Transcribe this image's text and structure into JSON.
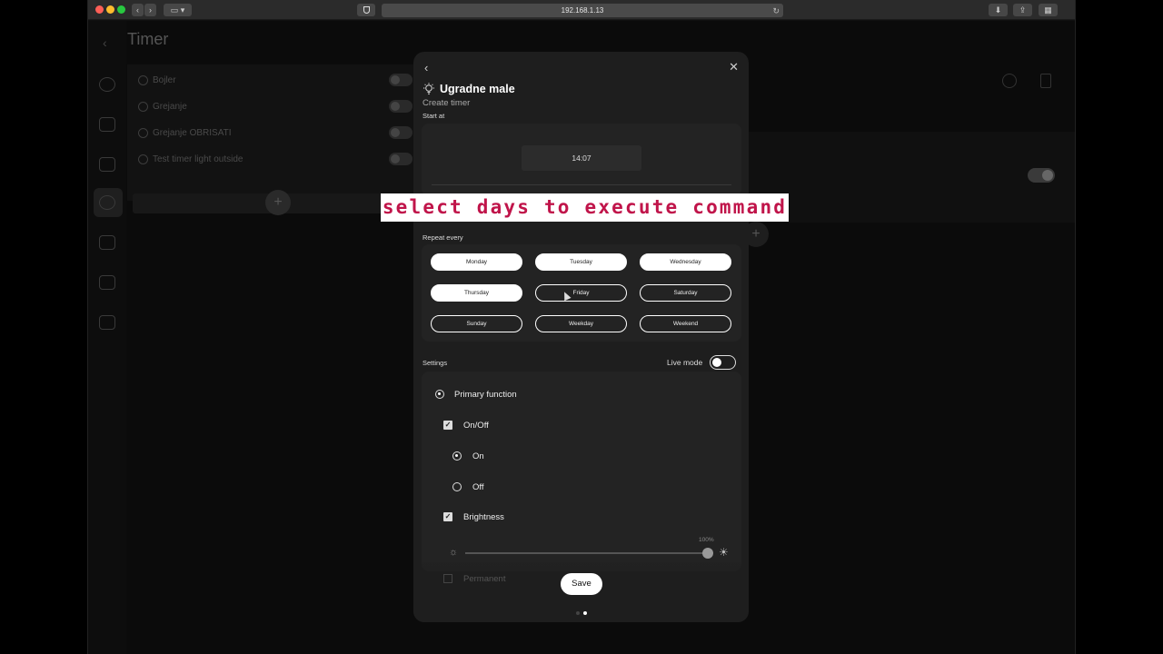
{
  "browser": {
    "url": "192.168.1.13"
  },
  "background": {
    "title": "Timer",
    "timers": [
      {
        "name": "Bojler"
      },
      {
        "name": "Grejanje"
      },
      {
        "name": "Grejanje OBRISATI"
      },
      {
        "name": "Test timer light outside"
      }
    ]
  },
  "modal": {
    "title": "Ugradne male",
    "subtitle": "Create timer",
    "start_label": "Start at",
    "start_time": "14:07",
    "repeat_label": "Repeat every",
    "days": [
      {
        "label": "Monday",
        "selected": true
      },
      {
        "label": "Tuesday",
        "selected": true
      },
      {
        "label": "Wednesday",
        "selected": true
      },
      {
        "label": "Thursday",
        "selected": true
      },
      {
        "label": "Friday",
        "selected": false
      },
      {
        "label": "Saturday",
        "selected": false
      },
      {
        "label": "Sunday",
        "selected": false
      },
      {
        "label": "Weekday",
        "selected": false
      },
      {
        "label": "Weekend",
        "selected": false
      }
    ],
    "settings_label": "Settings",
    "live_mode_label": "Live mode",
    "live_mode_on": false,
    "primary_function": "Primary function",
    "onoff_label": "On/Off",
    "on_label": "On",
    "off_label": "Off",
    "brightness_label": "Brightness",
    "brightness_value": "100%",
    "permanent_label": "Permanent",
    "save_label": "Save"
  },
  "caption": "select days to execute command"
}
